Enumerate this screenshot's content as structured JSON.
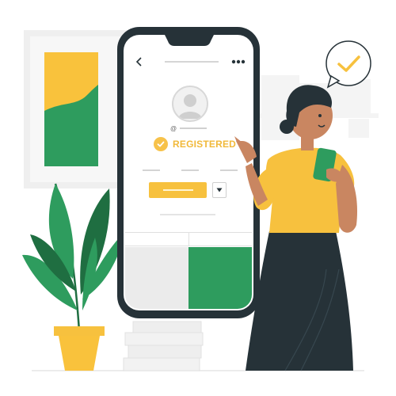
{
  "profile": {
    "handle_symbol": "@",
    "status_label": "REGISTERED"
  },
  "icons": {
    "back": "chevron-left-icon",
    "menu": "more-horizontal-icon",
    "status": "check-circle-icon",
    "confirmation": "check-bubble-icon",
    "dropdown": "caret-down-icon",
    "avatar": "user-icon"
  },
  "colors": {
    "accent_yellow": "#f7c13e",
    "accent_green": "#2e9c5e",
    "dark_green": "#1f6e41",
    "phone_body": "#263238",
    "tile_grey": "#ebebeb",
    "skirt": "#263238"
  }
}
